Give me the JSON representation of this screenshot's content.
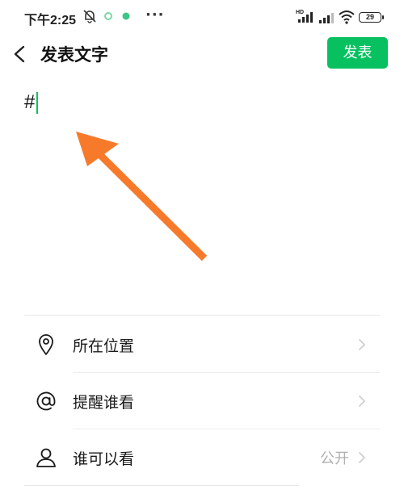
{
  "status_bar": {
    "time": "下午2:25",
    "dots": "···",
    "battery": "29",
    "icons": [
      "bell-muted-icon",
      "app-dot-icon",
      "app-dot-icon",
      "hd-signal-icon",
      "signal-icon",
      "wifi-icon",
      "battery-icon"
    ]
  },
  "header": {
    "back_icon": "chevron-left-icon",
    "title": "发表文字",
    "publish_label": "发表"
  },
  "composer": {
    "text": "#",
    "annotation": "orange-arrow-pointing-to-text"
  },
  "options": [
    {
      "label": "所在位置",
      "icon": "location-pin-icon",
      "value": ""
    },
    {
      "label": "提醒谁看",
      "icon": "at-sign-icon",
      "value": ""
    },
    {
      "label": "谁可以看",
      "icon": "person-icon",
      "value": "公开"
    }
  ],
  "colors": {
    "accent": "#07c160",
    "arrow": "#f77a2b",
    "text": "#1a1a1a",
    "secondary_text": "#b0b0b0"
  }
}
